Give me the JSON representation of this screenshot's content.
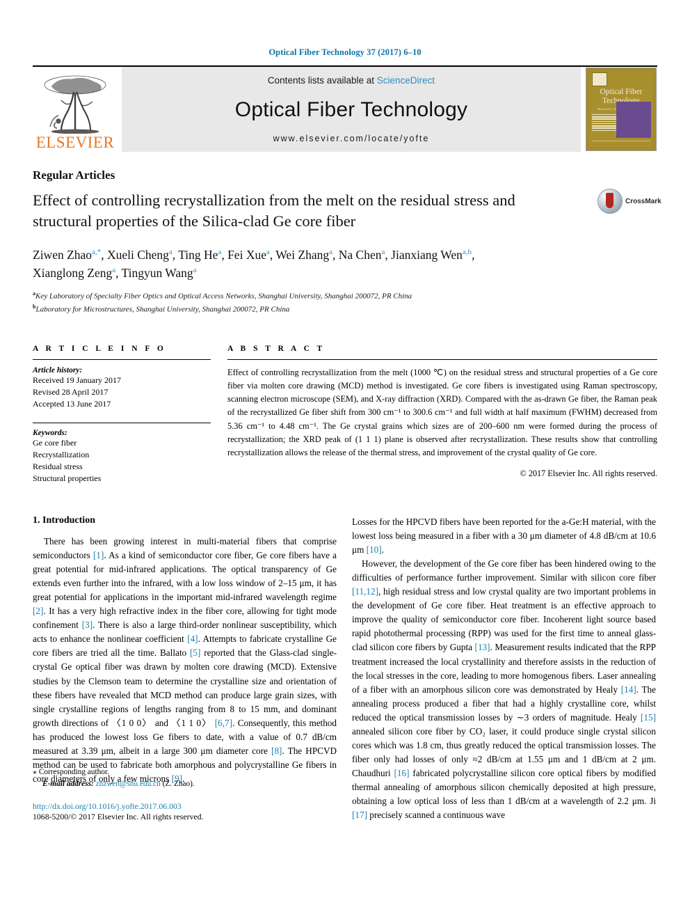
{
  "running_head": "Optical Fiber Technology 37 (2017) 6–10",
  "masthead": {
    "publisher": "ELSEVIER",
    "contents_prefix": "Contents lists available at",
    "contents_link": "ScienceDirect",
    "journal_name": "Optical Fiber Technology",
    "journal_url": "www.elsevier.com/locate/yofte",
    "cover": {
      "title_line1": "Optical Fiber",
      "title_line2": "Technology",
      "subtitle": "Materials, Devices and Systems"
    }
  },
  "article": {
    "type": "Regular Articles",
    "title": "Effect of controlling recrystallization from the melt on the residual stress and structural properties of the Silica-clad Ge core fiber",
    "crossmark_label": "CrossMark",
    "authors_line1": "Ziwen Zhao a,*, Xueli Cheng a, Ting He a, Fei Xue a, Wei Zhang a, Na Chen a, Jianxiang Wen a,b,",
    "authors_line2": "Xianglong Zeng a, Tingyun Wang a",
    "affiliation_a": "Key Laboratory of Specialty Fiber Optics and Optical Access Networks, Shanghai University, Shanghai 200072, PR China",
    "affiliation_b": "Laboratory for Microstructures, Shanghai University, Shanghai 200072, PR China"
  },
  "info": {
    "heading": "A R T I C L E   I N F O",
    "history_label": "Article history:",
    "received": "Received 19 January 2017",
    "revised": "Revised 28 April 2017",
    "accepted": "Accepted 13 June 2017",
    "keywords_label": "Keywords:",
    "keywords": [
      "Ge core fiber",
      "Recrystallization",
      "Residual stress",
      "Structural properties"
    ]
  },
  "abstract": {
    "heading": "A B S T R A C T",
    "text": "Effect of controlling recrystallization from the melt (1000 ℃) on the residual stress and structural properties of a Ge core fiber via molten core drawing (MCD) method is investigated. Ge core fibers is investigated using Raman spectroscopy, scanning electron microscope (SEM), and X-ray diffraction (XRD). Compared with the as-drawn Ge fiber, the Raman peak of the recrystallized Ge fiber shift from 300 cm⁻¹ to 300.6 cm⁻¹ and full width at half maximum (FWHM) decreased from 5.36 cm⁻¹ to 4.48 cm⁻¹. The Ge crystal grains which sizes are of 200–600 nm were formed during the process of recrystallization; the XRD peak of (1 1 1) plane is observed after recrystallization. These results show that controlling recrystallization allows the release of the thermal stress, and improvement of the crystal quality of Ge core.",
    "copyright": "© 2017 Elsevier Inc. All rights reserved."
  },
  "introduction": {
    "heading": "1. Introduction",
    "left_para_1": "There has been growing interest in multi-material fibers that comprise semiconductors [1]. As a kind of semiconductor core fiber, Ge core fibers have a great potential for mid-infrared applications. The optical transparency of Ge extends even further into the infrared, with a low loss window of 2–15 μm, it has great potential for applications in the important mid-infrared wavelength regime [2]. It has a very high refractive index in the fiber core, allowing for tight mode confinement [3]. There is also a large third-order nonlinear susceptibility, which acts to enhance the nonlinear coefficient [4]. Attempts to fabricate crystalline Ge core fibers are tried all the time. Ballato [5] reported that the Glass-clad single-crystal Ge optical fiber was drawn by molten core drawing (MCD). Extensive studies by the Clemson team to determine the crystalline size and orientation of these fibers have revealed that MCD method can produce large grain sizes, with single crystalline regions of lengths ranging from 8 to 15 mm, and dominant growth directions of 〈1 0 0〉 and 〈1 1 0〉 [6,7]. Consequently, this method has produced the lowest loss Ge fibers to date, with a value of 0.7 dB/cm measured at 3.39 μm, albeit in a large 300 μm diameter core [8]. The HPCVD method can be used to fabricate both amorphous and polycrystalline Ge fibers in core diameters of only a few microns [9].",
    "right_para_1": "Losses for the HPCVD fibers have been reported for the a-Ge:H material, with the lowest loss being measured in a fiber with a 30 μm diameter of 4.8 dB/cm at 10.6 μm [10].",
    "right_para_2": "However, the development of the Ge core fiber has been hindered owing to the difficulties of performance further improvement. Similar with silicon core fiber [11,12], high residual stress and low crystal quality are two important problems in the development of Ge core fiber. Heat treatment is an effective approach to improve the quality of semiconductor core fiber. Incoherent light source based rapid photothermal processing (RPP) was used for the first time to anneal glass-clad silicon core fibers by Gupta [13]. Measurement results indicated that the RPP treatment increased the local crystallinity and therefore assists in the reduction of the local stresses in the core, leading to more homogenous fibers. Laser annealing of a fiber with an amorphous silicon core was demonstrated by Healy [14]. The annealing process produced a fiber that had a highly crystalline core, whilst reduced the optical transmission losses by ∼3 orders of magnitude. Healy [15] annealed silicon core fiber by CO₂ laser, it could produce single crystal silicon cores which was 1.8 cm, thus greatly reduced the optical transmission losses. The fiber only had losses of only ≈2 dB/cm at 1.55 μm and 1 dB/cm at 2 μm. Chaudhuri [16] fabricated polycrystalline silicon core optical fibers by modified thermal annealing of amorphous silicon chemically deposited at high pressure, obtaining a low optical loss of less than 1 dB/cm at a wavelength of 2.2 μm. Ji [17] precisely scanned a continuous wave"
  },
  "footnote": {
    "corresponding": "Corresponding author.",
    "email_label": "E-mail address:",
    "email": "zhzwen@shu.edu.cn",
    "email_suffix": "(Z. Zhao).",
    "doi": "http://dx.doi.org/10.1016/j.yofte.2017.06.003",
    "issn": "1068-5200/© 2017 Elsevier Inc. All rights reserved."
  },
  "colors": {
    "link": "#1a7fae",
    "running_head": "#0a74a8",
    "elsevier_orange": "#e87722",
    "sciencedirect": "#2d8ec4"
  }
}
